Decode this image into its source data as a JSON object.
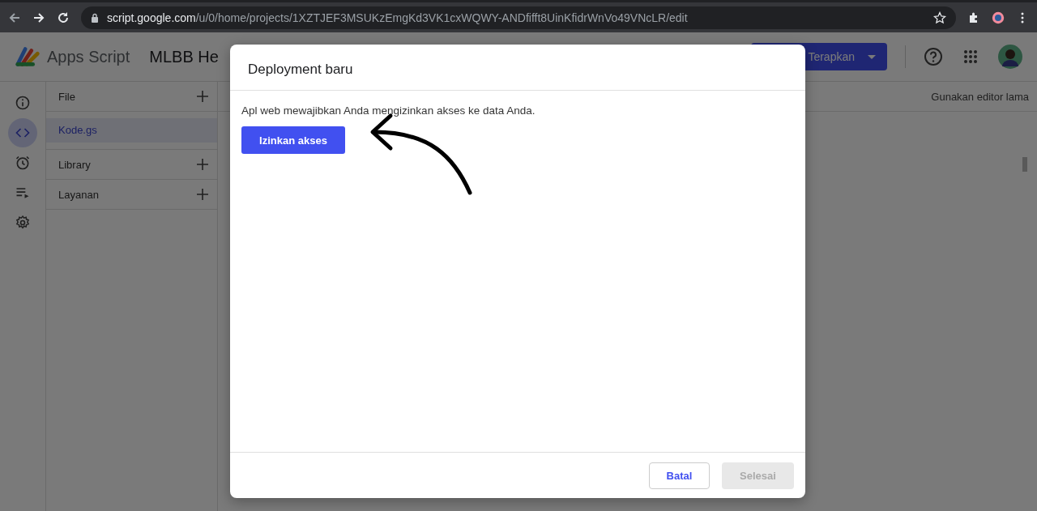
{
  "browser": {
    "url_host": "script.google.com",
    "url_path": "/u/0/home/projects/1XZTJEF3MSUKzEmgKd3VK1cxWQWY-ANDfifft8UinKfidrWnVo49VNcLR/edit"
  },
  "header": {
    "app_name": "Apps Script",
    "project_title": "MLBB He",
    "deploy_button": "Terapkan"
  },
  "rail": [
    {
      "kind": "info",
      "selected": false
    },
    {
      "kind": "code",
      "selected": true
    },
    {
      "kind": "clock",
      "selected": false
    },
    {
      "kind": "executions",
      "selected": false
    },
    {
      "kind": "settings",
      "selected": false
    }
  ],
  "sections": [
    {
      "title": "File",
      "files": [
        {
          "name": "Kode.gs",
          "selected": true
        }
      ]
    },
    {
      "title": "Library"
    },
    {
      "title": "Layanan"
    }
  ],
  "editor": {
    "legacy_link": "Gunakan editor lama"
  },
  "dialog": {
    "title": "Deployment baru",
    "message": "Apl web mewajibkan Anda mengizinkan akses ke data Anda.",
    "authorize_button": "Izinkan akses",
    "buttons": [
      {
        "label": "Batal",
        "disabled": false
      },
      {
        "label": "Selesai",
        "disabled": true
      }
    ]
  }
}
